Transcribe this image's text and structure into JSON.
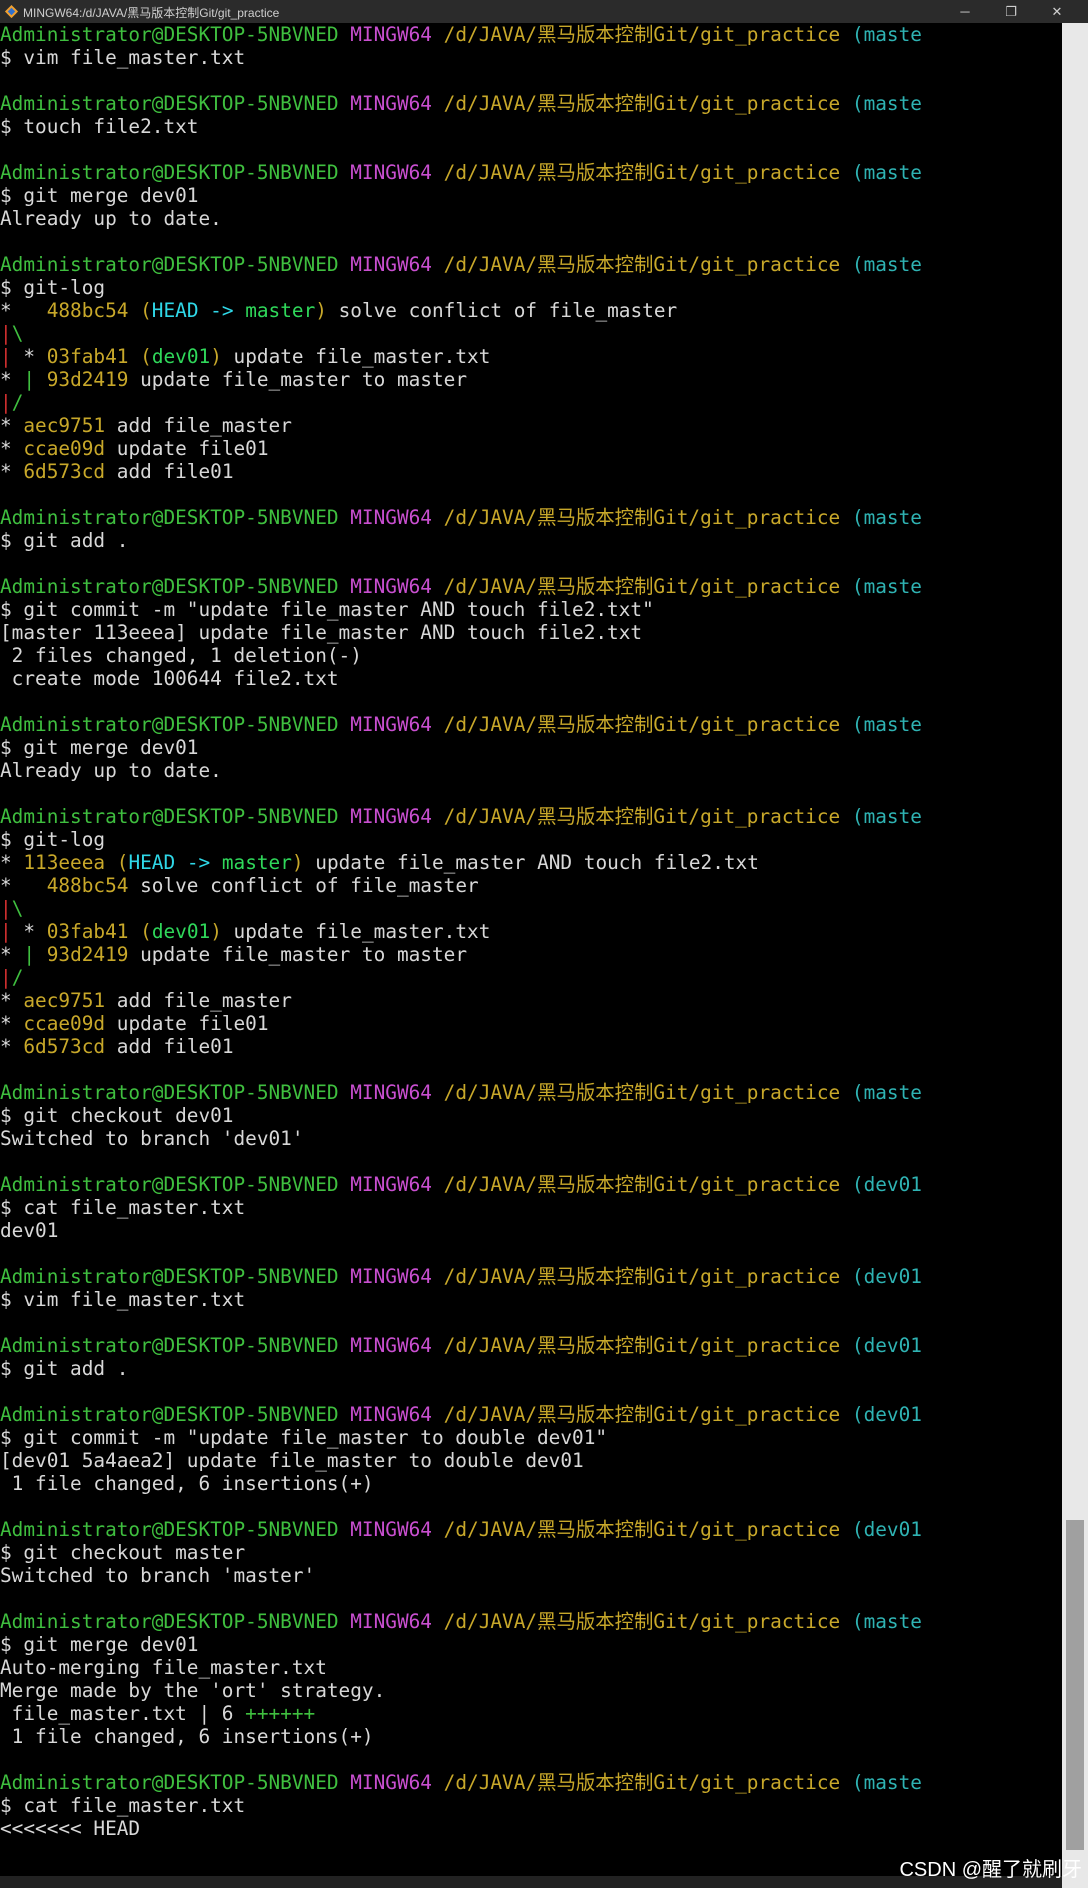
{
  "window": {
    "title": "MINGW64:/d/JAVA/黑马版本控制Git/git_practice",
    "minimize_glyph": "─",
    "maximize_glyph": "❐",
    "close_glyph": "✕",
    "icon": "git-bash-diamond-icon"
  },
  "prompt": {
    "user": "Administrator@DESKTOP-5NBVNED",
    "env": "MINGW64",
    "path": "/d/JAVA/黑马版本控制Git/git_practice",
    "branch_master": "(maste",
    "branch_dev01": "(dev01"
  },
  "lines": [
    {
      "kind": "prompt",
      "branch": "(maste"
    },
    {
      "kind": "text",
      "text": "$ vim file_master.txt"
    },
    {
      "kind": "blank"
    },
    {
      "kind": "prompt",
      "branch": "(maste"
    },
    {
      "kind": "text",
      "text": "$ touch file2.txt"
    },
    {
      "kind": "blank"
    },
    {
      "kind": "prompt",
      "branch": "(maste"
    },
    {
      "kind": "text",
      "text": "$ git merge dev01"
    },
    {
      "kind": "text",
      "text": "Already up to date."
    },
    {
      "kind": "blank"
    },
    {
      "kind": "prompt",
      "branch": "(maste"
    },
    {
      "kind": "text",
      "text": "$ git-log"
    },
    {
      "kind": "log",
      "graph": "*   ",
      "hash": "488bc54",
      "refs": "HEAD -> master",
      "msg": " solve conflict of file_master"
    },
    {
      "kind": "graph",
      "g1": "|",
      "g2": "\\"
    },
    {
      "kind": "log2",
      "lead": "| ",
      "star": "* ",
      "hash": "03fab41",
      "dref": "dev01",
      "msg": " update file_master.txt"
    },
    {
      "kind": "log3",
      "lead": "* ",
      "bar": "| ",
      "hash": "93d2419",
      "msg": " update file_master to master"
    },
    {
      "kind": "graph",
      "g1": "|",
      "g2": "/"
    },
    {
      "kind": "log",
      "graph": "* ",
      "hash": "aec9751",
      "msg": " add file_master"
    },
    {
      "kind": "log",
      "graph": "* ",
      "hash": "ccae09d",
      "msg": " update file01"
    },
    {
      "kind": "log",
      "graph": "* ",
      "hash": "6d573cd",
      "msg": " add file01"
    },
    {
      "kind": "blank"
    },
    {
      "kind": "prompt",
      "branch": "(maste"
    },
    {
      "kind": "text",
      "text": "$ git add ."
    },
    {
      "kind": "blank"
    },
    {
      "kind": "prompt",
      "branch": "(maste"
    },
    {
      "kind": "text",
      "text": "$ git commit -m \"update file_master AND touch file2.txt\""
    },
    {
      "kind": "text",
      "text": "[master 113eeea] update file_master AND touch file2.txt"
    },
    {
      "kind": "text",
      "text": " 2 files changed, 1 deletion(-)"
    },
    {
      "kind": "text",
      "text": " create mode 100644 file2.txt"
    },
    {
      "kind": "blank"
    },
    {
      "kind": "prompt",
      "branch": "(maste"
    },
    {
      "kind": "text",
      "text": "$ git merge dev01"
    },
    {
      "kind": "text",
      "text": "Already up to date."
    },
    {
      "kind": "blank"
    },
    {
      "kind": "prompt",
      "branch": "(maste"
    },
    {
      "kind": "text",
      "text": "$ git-log"
    },
    {
      "kind": "log",
      "graph": "* ",
      "hash": "113eeea",
      "refs": "HEAD -> master",
      "msg": " update file_master AND touch file2.txt"
    },
    {
      "kind": "log",
      "graph": "*   ",
      "hash": "488bc54",
      "msg": " solve conflict of file_master"
    },
    {
      "kind": "graph",
      "g1": "|",
      "g2": "\\"
    },
    {
      "kind": "log2",
      "lead": "| ",
      "star": "* ",
      "hash": "03fab41",
      "dref": "dev01",
      "msg": " update file_master.txt"
    },
    {
      "kind": "log3",
      "lead": "* ",
      "bar": "| ",
      "hash": "93d2419",
      "msg": " update file_master to master"
    },
    {
      "kind": "graph",
      "g1": "|",
      "g2": "/"
    },
    {
      "kind": "log",
      "graph": "* ",
      "hash": "aec9751",
      "msg": " add file_master"
    },
    {
      "kind": "log",
      "graph": "* ",
      "hash": "ccae09d",
      "msg": " update file01"
    },
    {
      "kind": "log",
      "graph": "* ",
      "hash": "6d573cd",
      "msg": " add file01"
    },
    {
      "kind": "blank"
    },
    {
      "kind": "prompt",
      "branch": "(maste"
    },
    {
      "kind": "text",
      "text": "$ git checkout dev01"
    },
    {
      "kind": "text",
      "text": "Switched to branch 'dev01'"
    },
    {
      "kind": "blank"
    },
    {
      "kind": "prompt",
      "branch": "(dev01"
    },
    {
      "kind": "text",
      "text": "$ cat file_master.txt"
    },
    {
      "kind": "text",
      "text": "dev01"
    },
    {
      "kind": "blank"
    },
    {
      "kind": "prompt",
      "branch": "(dev01"
    },
    {
      "kind": "text",
      "text": "$ vim file_master.txt"
    },
    {
      "kind": "blank"
    },
    {
      "kind": "prompt",
      "branch": "(dev01"
    },
    {
      "kind": "text",
      "text": "$ git add ."
    },
    {
      "kind": "blank"
    },
    {
      "kind": "prompt",
      "branch": "(dev01"
    },
    {
      "kind": "text",
      "text": "$ git commit -m \"update file_master to double dev01\""
    },
    {
      "kind": "text",
      "text": "[dev01 5a4aea2] update file_master to double dev01"
    },
    {
      "kind": "text",
      "text": " 1 file changed, 6 insertions(+)"
    },
    {
      "kind": "blank"
    },
    {
      "kind": "prompt",
      "branch": "(dev01"
    },
    {
      "kind": "text",
      "text": "$ git checkout master"
    },
    {
      "kind": "text",
      "text": "Switched to branch 'master'"
    },
    {
      "kind": "blank"
    },
    {
      "kind": "prompt",
      "branch": "(maste"
    },
    {
      "kind": "text",
      "text": "$ git merge dev01"
    },
    {
      "kind": "text",
      "text": "Auto-merging file_master.txt"
    },
    {
      "kind": "text",
      "text": "Merge made by the 'ort' strategy."
    },
    {
      "kind": "stat",
      "text": " file_master.txt | 6 ",
      "plus": "++++++"
    },
    {
      "kind": "text",
      "text": " 1 file changed, 6 insertions(+)"
    },
    {
      "kind": "blank"
    },
    {
      "kind": "prompt",
      "branch": "(maste"
    },
    {
      "kind": "text",
      "text": "$ cat file_master.txt"
    },
    {
      "kind": "text",
      "text": "<<<<<<< HEAD"
    }
  ],
  "watermark": "CSDN @醒了就刷牙"
}
